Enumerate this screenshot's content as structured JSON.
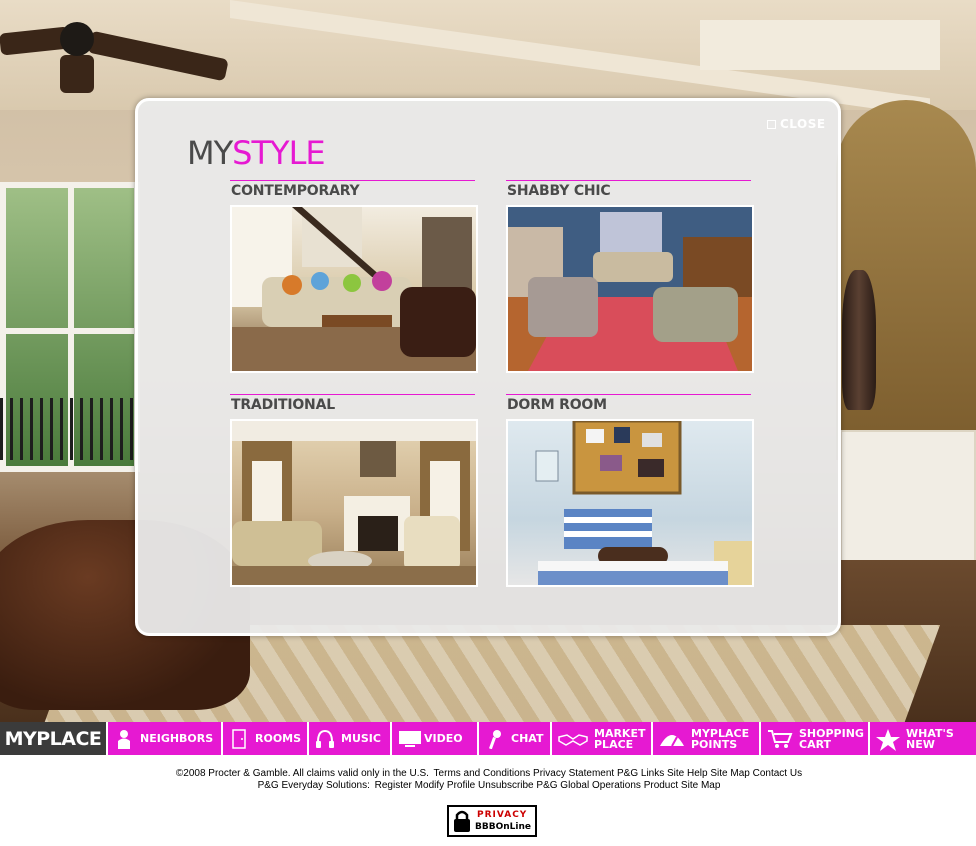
{
  "modal": {
    "close_label": "CLOSE",
    "title_part1": "MY",
    "title_part2": "STYLE",
    "categories": [
      {
        "label": "CONTEMPORARY"
      },
      {
        "label": "SHABBY CHIC"
      },
      {
        "label": "TRADITIONAL"
      },
      {
        "label": "DORM ROOM"
      }
    ]
  },
  "nav": {
    "home": "MYPLACE",
    "items": [
      {
        "line1": "NEIGHBORS",
        "line2": "",
        "icon": "person-icon"
      },
      {
        "line1": "ROOMS",
        "line2": "",
        "icon": "door-icon"
      },
      {
        "line1": "MUSIC",
        "line2": "",
        "icon": "headphones-icon"
      },
      {
        "line1": "VIDEO",
        "line2": "",
        "icon": "monitor-icon"
      },
      {
        "line1": "CHAT",
        "line2": "",
        "icon": "microphone-icon"
      },
      {
        "line1": "MARKET",
        "line2": "PLACE",
        "icon": "handshake-icon"
      },
      {
        "line1": "MYPLACE",
        "line2": "POINTS",
        "icon": "gauge-icon"
      },
      {
        "line1": "SHOPPING",
        "line2": "CART",
        "icon": "cart-icon"
      },
      {
        "line1": "WHAT'S",
        "line2": "NEW",
        "icon": "star-icon"
      }
    ]
  },
  "footer": {
    "copyright": "©2008 Procter & Gamble. All claims valid only in the U.S.",
    "links1": [
      "Terms and Conditions",
      "Privacy Statement",
      "P&G Links",
      "Site Help",
      "Site Map",
      "Contact Us"
    ],
    "prefix2": "P&G Everyday Solutions:",
    "links2": [
      "Register",
      "Modify Profile",
      "Unsubscribe",
      "P&G Global Operations",
      "Product Site Map"
    ],
    "badge_line1": "PRIVACY",
    "badge_line2": "BBBOnLine"
  },
  "colors": {
    "accent": "#e619d2",
    "dark": "#3b3b3b"
  }
}
